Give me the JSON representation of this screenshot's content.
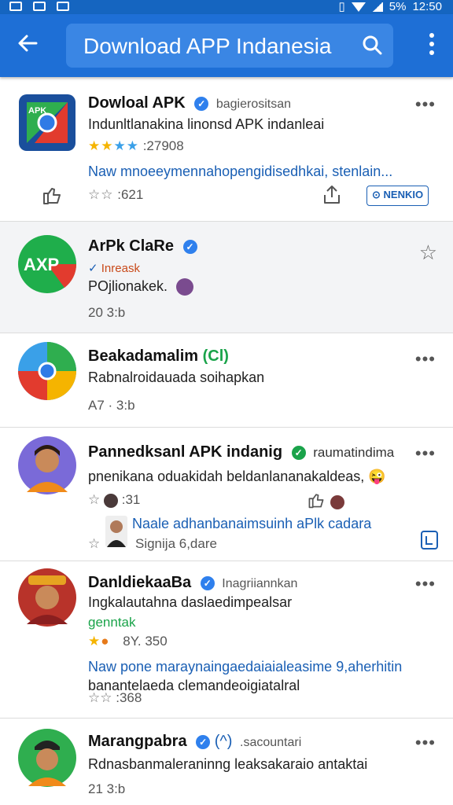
{
  "status_bar": {
    "battery": "5%",
    "time": "12:50"
  },
  "app_bar": {
    "search_query": "Download APP Indanesia"
  },
  "results": [
    {
      "title": "Dowloal APK",
      "subtitle": "bagierositsan",
      "description": "Indunltlanakina linonsd APK indanleai",
      "rating_count": ":27908",
      "link_text": "Naw mnoeeymennahopengidisedhkai, stenlain...",
      "footer_meta": ":621",
      "action_label": "NENKIO"
    },
    {
      "title": "ArPk ClaRe",
      "tag": "Inreask",
      "description": "POjlionakek.",
      "meta": "20    3:b"
    },
    {
      "title": "Beakadamalim",
      "badge": "(Cl)",
      "description": "Rabnalroidauada soihapkan",
      "meta": "A7  ·  3:b"
    },
    {
      "title": "Pannedksanl APK indanig",
      "subtitle": "raumatindima",
      "description": "pnenikana oduakidah beldanlananakaldeas,",
      "meta": ":31",
      "reply_name": "Naale adhanbanaimsuinh aPlk cadara",
      "reply_meta": "Signija 6,dare"
    },
    {
      "title": "DanldiekaaBa",
      "subtitle": "Inagriiannkan",
      "description": "Ingkalautahna daslaedimpealsar",
      "tag": "genntak",
      "rating_count": "8Y.  350",
      "link_text": "Naw pone maraynaingaedaiaialeasime 9,aherhitin",
      "line2": "banantelaeda clemandeoigiatalral",
      "meta": ":368"
    },
    {
      "title": "Marangpabra",
      "badge": "(^)",
      "subtitle": ".sacountari",
      "description": "Rdnasbanmaleraninng leaksakaraio antaktai",
      "meta": "21    3:b"
    }
  ],
  "colors": {
    "app_bar": "#1e6fd6",
    "search_box": "#3a86e4",
    "link": "#1a5fb4",
    "verified": "#2f80ed"
  }
}
